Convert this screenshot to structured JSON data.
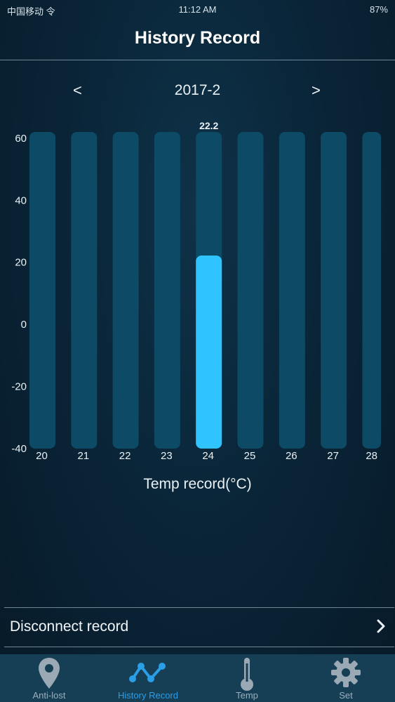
{
  "status_bar": {
    "carrier": "中国移动 令",
    "time": "11:12 AM",
    "battery": "87%"
  },
  "header": {
    "title": "History Record"
  },
  "period": {
    "prev_label": "<",
    "next_label": ">",
    "month": "2017-2"
  },
  "chart_data": {
    "type": "bar",
    "categories": [
      "20",
      "21",
      "22",
      "23",
      "24",
      "25",
      "26",
      "27",
      "28"
    ],
    "values": [
      null,
      null,
      null,
      null,
      22.2,
      null,
      null,
      null,
      null
    ],
    "selected_index": 4,
    "selected_label": "22.2",
    "ylim": [
      -40,
      62
    ],
    "yticks": [
      60,
      40,
      20,
      0,
      -20,
      -40
    ],
    "caption": "Temp record(°C)",
    "colors": {
      "track": "#0c4a66",
      "bar": "#2fc4ff",
      "text": "#e9f1f5"
    }
  },
  "disconnect_row": {
    "label": "Disconnect record"
  },
  "tabs": [
    {
      "label": "Anti-lost",
      "icon": "location-pin-icon",
      "active": false
    },
    {
      "label": "History Record",
      "icon": "line-graph-icon",
      "active": true
    },
    {
      "label": "Temp",
      "icon": "thermometer-icon",
      "active": false
    },
    {
      "label": "Set",
      "icon": "gear-icon",
      "active": false
    }
  ]
}
